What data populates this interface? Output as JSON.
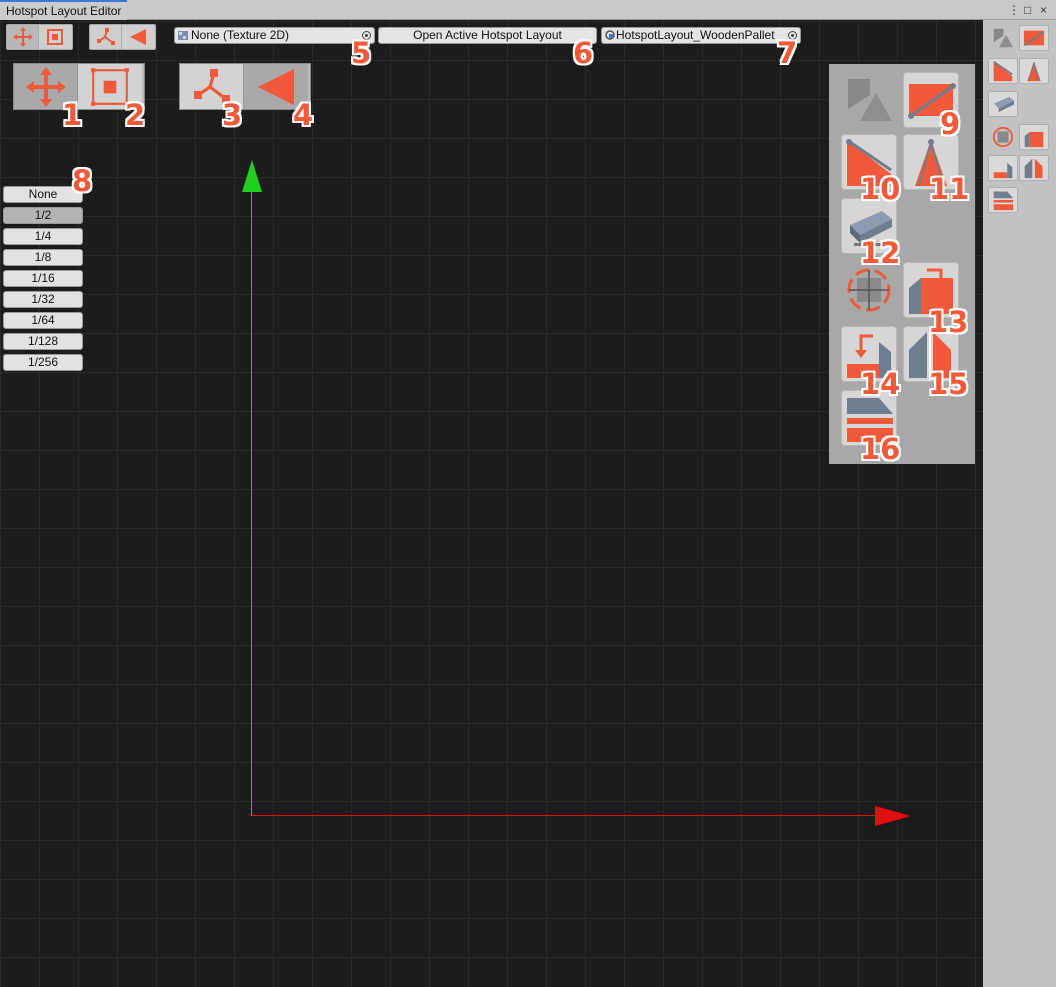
{
  "window": {
    "title": "Hotspot Layout Editor",
    "menu_glyph": "⋮",
    "maximize_glyph": "□",
    "close_glyph": "×"
  },
  "toolbar": {
    "texture_field": {
      "value": "None (Texture 2D)",
      "icon": "texture-icon"
    },
    "open_button": "Open Active Hotspot Layout",
    "layout_field": {
      "value": "HotspotLayout_WoodenPallet",
      "icon": "asset-icon"
    }
  },
  "snap_options": [
    "None",
    "1/2",
    "1/4",
    "1/8",
    "1/16",
    "1/32",
    "1/64",
    "1/128",
    "1/256"
  ],
  "snap_selected": "1/2",
  "badges": [
    "1",
    "2",
    "3",
    "4",
    "5",
    "6",
    "7",
    "8",
    "9",
    "10",
    "11",
    "12",
    "13",
    "14",
    "15",
    "16"
  ],
  "colors": {
    "accent": "#f05a3a",
    "axis_x": "#e01010",
    "axis_y": "#20d020",
    "canvas": "#1c1c1c",
    "panel": "#a8a8a8"
  },
  "icons": {
    "move": "move-arrows-icon",
    "rect": "rect-select-icon",
    "pivot": "pivot-icon",
    "arrow": "arrow-left-icon",
    "shapes": "shapes-icon",
    "edge": "edge-icon",
    "slope": "slope-icon",
    "tent": "tent-icon",
    "block": "block-icon",
    "target": "target-icon",
    "rot_a": "rotate-right-icon",
    "rot_b": "rotate-left-icon",
    "mirror": "mirror-icon",
    "stack": "stack-icon"
  }
}
